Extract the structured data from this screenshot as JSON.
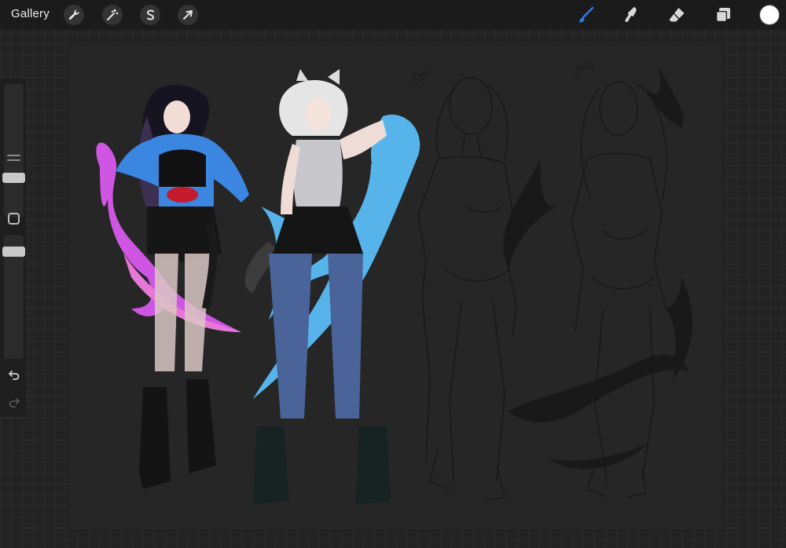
{
  "topbar": {
    "gallery_label": "Gallery",
    "actions": [
      {
        "name": "actions-wrench",
        "icon": "wrench-icon"
      },
      {
        "name": "adjustments",
        "icon": "magic-wand-icon"
      },
      {
        "name": "selection",
        "icon": "selection-s-icon"
      },
      {
        "name": "transform",
        "icon": "arrow-cursor-icon"
      }
    ],
    "tools": [
      {
        "name": "brush",
        "icon": "brush-icon",
        "active": true
      },
      {
        "name": "smudge",
        "icon": "smudge-finger-icon",
        "active": false
      },
      {
        "name": "eraser",
        "icon": "eraser-icon",
        "active": false
      },
      {
        "name": "layers",
        "icon": "layers-icon",
        "active": false
      }
    ],
    "current_color": "#ffffff",
    "active_tool_color": "#2f7bf5"
  },
  "sidebar": {
    "brush_size_level": 0.2,
    "opacity_level": 0.05,
    "undo_icon": "undo-arrow-icon",
    "redo_icon": "redo-arrow-icon"
  },
  "canvas": {
    "sketch_labels": [
      "Zyo",
      "Jelli"
    ],
    "palette": {
      "left_character_top": "#3b86e0",
      "left_character_flame": "#d85be6",
      "right_character_flame": "#5ab6ec",
      "sketch_line": "#161616"
    }
  }
}
